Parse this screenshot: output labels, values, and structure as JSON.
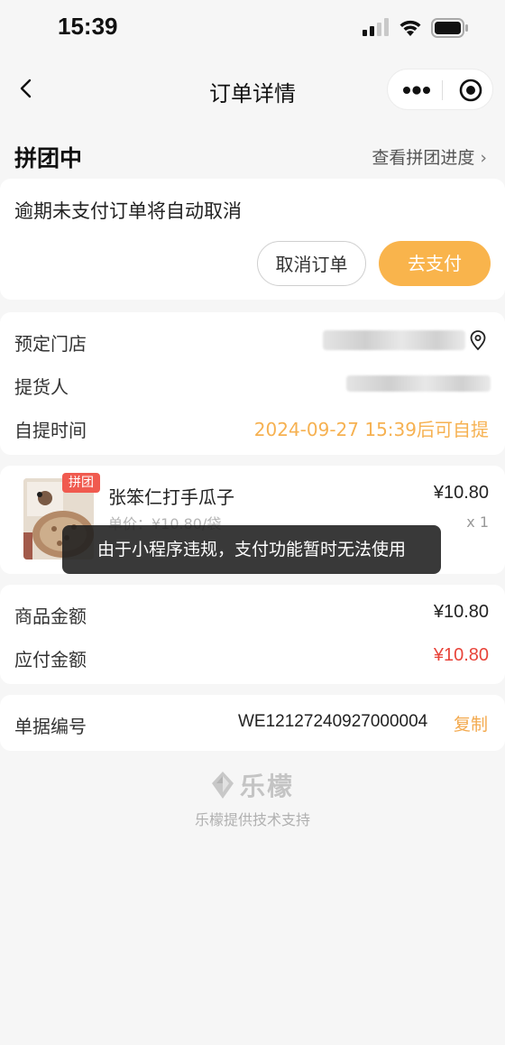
{
  "status_bar": {
    "time": "15:39"
  },
  "nav": {
    "title": "订单详情"
  },
  "order_status": {
    "title": "拼团中",
    "progress_link": "查看拼团进度",
    "chevron": "›"
  },
  "payment": {
    "notice": "逾期未支付订单将自动取消",
    "cancel_label": "取消订单",
    "pay_label": "去支付"
  },
  "info": {
    "store_label": "预定门店",
    "picker_label": "提货人",
    "pickup_time_label": "自提时间",
    "pickup_time_value": "2024-09-27 15:39后可自提"
  },
  "item": {
    "tag": "拼团",
    "name": "张笨仁打手瓜子",
    "price": "¥10.80",
    "unit_price": "单价：¥10.80/袋",
    "quantity": "x 1"
  },
  "toast": {
    "message": "由于小程序违规，支付功能暂时无法使用"
  },
  "amounts": {
    "goods_label": "商品金额",
    "goods_value": "¥10.80",
    "payable_label": "应付金额",
    "payable_value": "¥10.80"
  },
  "order_number": {
    "label": "单据编号",
    "value": "WE12127240927000004",
    "copy_label": "复制"
  },
  "footer": {
    "brand": "乐檬",
    "support": "乐檬提供技术支持"
  },
  "colors": {
    "accent_orange": "#f9b44c",
    "pickup_orange": "#f6b151",
    "price_red": "#e8443a",
    "tag_red": "#f05a4f"
  },
  "icons": [
    "signal-icon",
    "wifi-icon",
    "battery-icon",
    "back-icon",
    "more-icon",
    "close-circle-icon",
    "chevron-right-icon",
    "location-icon",
    "lemeng-logo-icon"
  ]
}
